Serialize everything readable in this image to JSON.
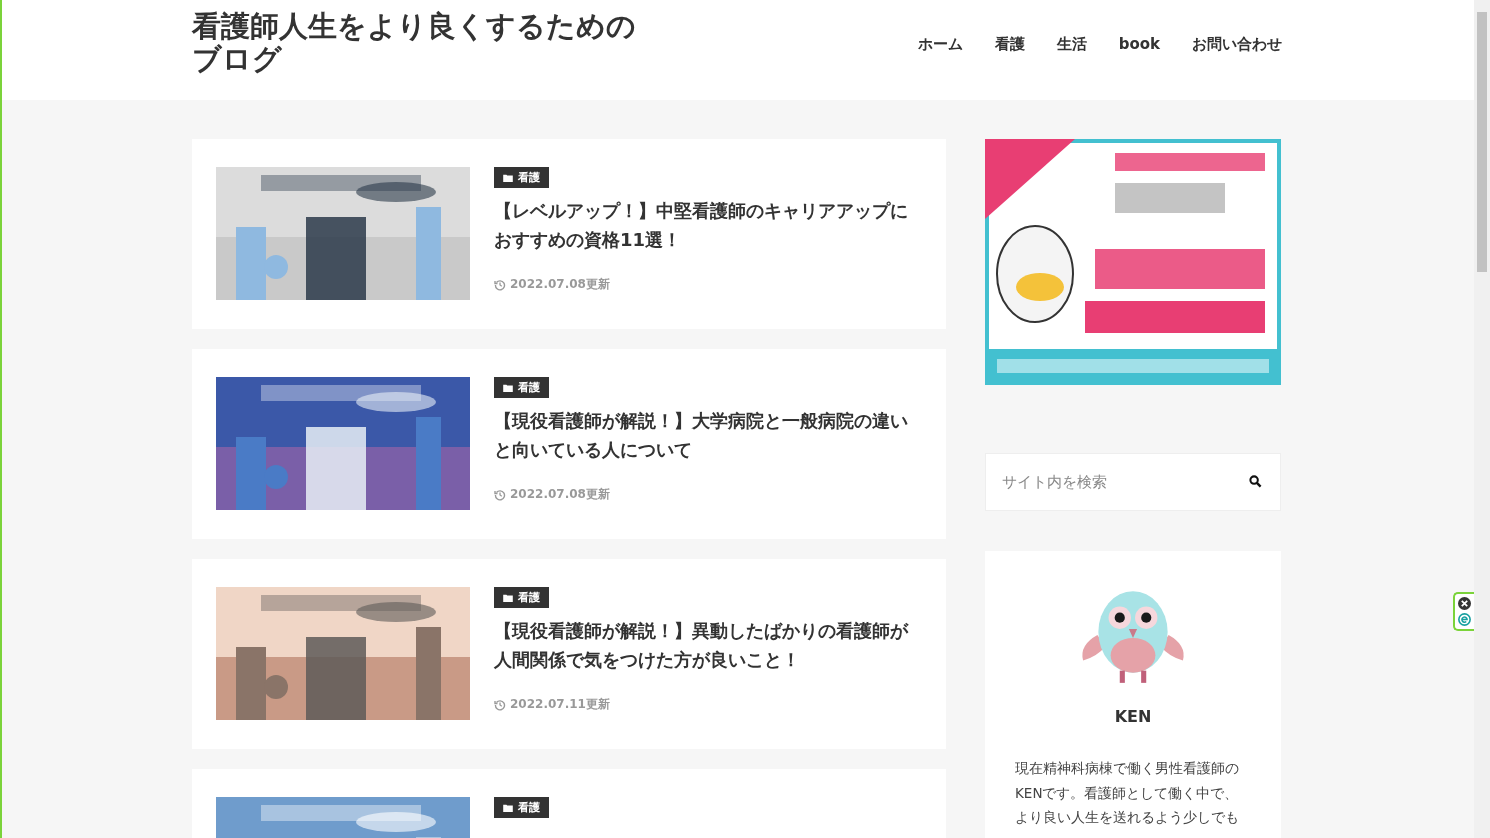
{
  "site_title": "看護師人生をより良くするためのブログ",
  "nav": [
    {
      "label": "ホーム"
    },
    {
      "label": "看護"
    },
    {
      "label": "生活"
    },
    {
      "label": "book"
    },
    {
      "label": "お問い合わせ"
    }
  ],
  "posts": [
    {
      "category": "看護",
      "title": "【レベルアップ！】中堅看護師のキャリアアップにおすすめの資格11選！",
      "date": "2022.07.08更新"
    },
    {
      "category": "看護",
      "title": "【現役看護師が解説！】大学病院と一般病院の違いと向いている人について",
      "date": "2022.07.08更新"
    },
    {
      "category": "看護",
      "title": "【現役看護師が解説！】異動したばかりの看護師が人間関係で気をつけた方が良いこと！",
      "date": "2022.07.11更新"
    },
    {
      "category": "看護"
    }
  ],
  "sidebar": {
    "search": {
      "placeholder": "サイト内を検索"
    },
    "profile": {
      "name": "KEN",
      "bio": "現在精神科病棟で働く男性看護師のKENです。看護師として働く中で、より良い人生を送れるよう少しでも"
    }
  }
}
